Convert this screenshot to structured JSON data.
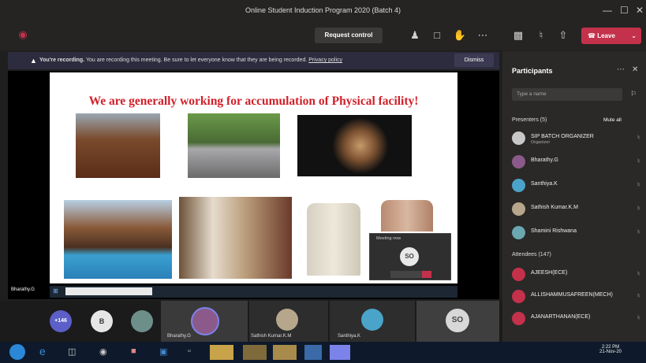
{
  "window": {
    "title": "Online Student Induction Program 2020 (Batch 4)"
  },
  "toolbar": {
    "request_control": "Request control",
    "leave": "Leave"
  },
  "banner": {
    "bold": "You're recording.",
    "text": "You are recording this meeting. Be sure to let everyone know that they are being recorded.",
    "link": "Privacy policy",
    "dismiss": "Dismiss"
  },
  "slide": {
    "title": "We are generally working for accumulation of Physical facility!"
  },
  "stage": {
    "presenter_label": "Bharathy.G",
    "popup_title": "Meeting now",
    "popup_initials": "SO"
  },
  "participants": {
    "header": "Participants",
    "search_placeholder": "Type a name",
    "presenters_label": "Presenters (5)",
    "mute_all": "Mute all",
    "presenters": [
      {
        "name": "SIP BATCH ORGANIZER",
        "sub": "Organizer",
        "color": "#c8c8c8"
      },
      {
        "name": "Bharathy.G",
        "sub": "",
        "color": "#8c5a8a"
      },
      {
        "name": "Santhiya.K",
        "sub": "",
        "color": "#4aa3c8"
      },
      {
        "name": "Sathish Kumar.K.M",
        "sub": "",
        "color": "#b6a78c"
      },
      {
        "name": "Shamini Rishwana",
        "sub": "",
        "color": "#6aa7b0"
      }
    ],
    "attendees_label": "Attendees (147)",
    "attendees": [
      {
        "name": "AJEESH(ECE)",
        "color": "#c4314b"
      },
      {
        "name": "ALLISHAMMUSAFREEN(MECH)",
        "color": "#c4314b"
      },
      {
        "name": "AJANARTHANAN(ECE)",
        "color": "#c4314b"
      }
    ]
  },
  "strip": {
    "tiles": [
      {
        "initials": "+146",
        "color": "#5b5fc7"
      },
      {
        "initials": "B",
        "color": "#e6e6e6"
      },
      {
        "initials": "",
        "color": "#6d8f8a"
      }
    ],
    "videos": [
      {
        "name": "Bharathy.G"
      },
      {
        "name": "Sathish Kumar.K.M"
      },
      {
        "name": "Santhiya.K"
      }
    ],
    "self_initials": "SO"
  },
  "taskbar": {
    "time": "2:22 PM",
    "date": "21-Nov-20"
  }
}
